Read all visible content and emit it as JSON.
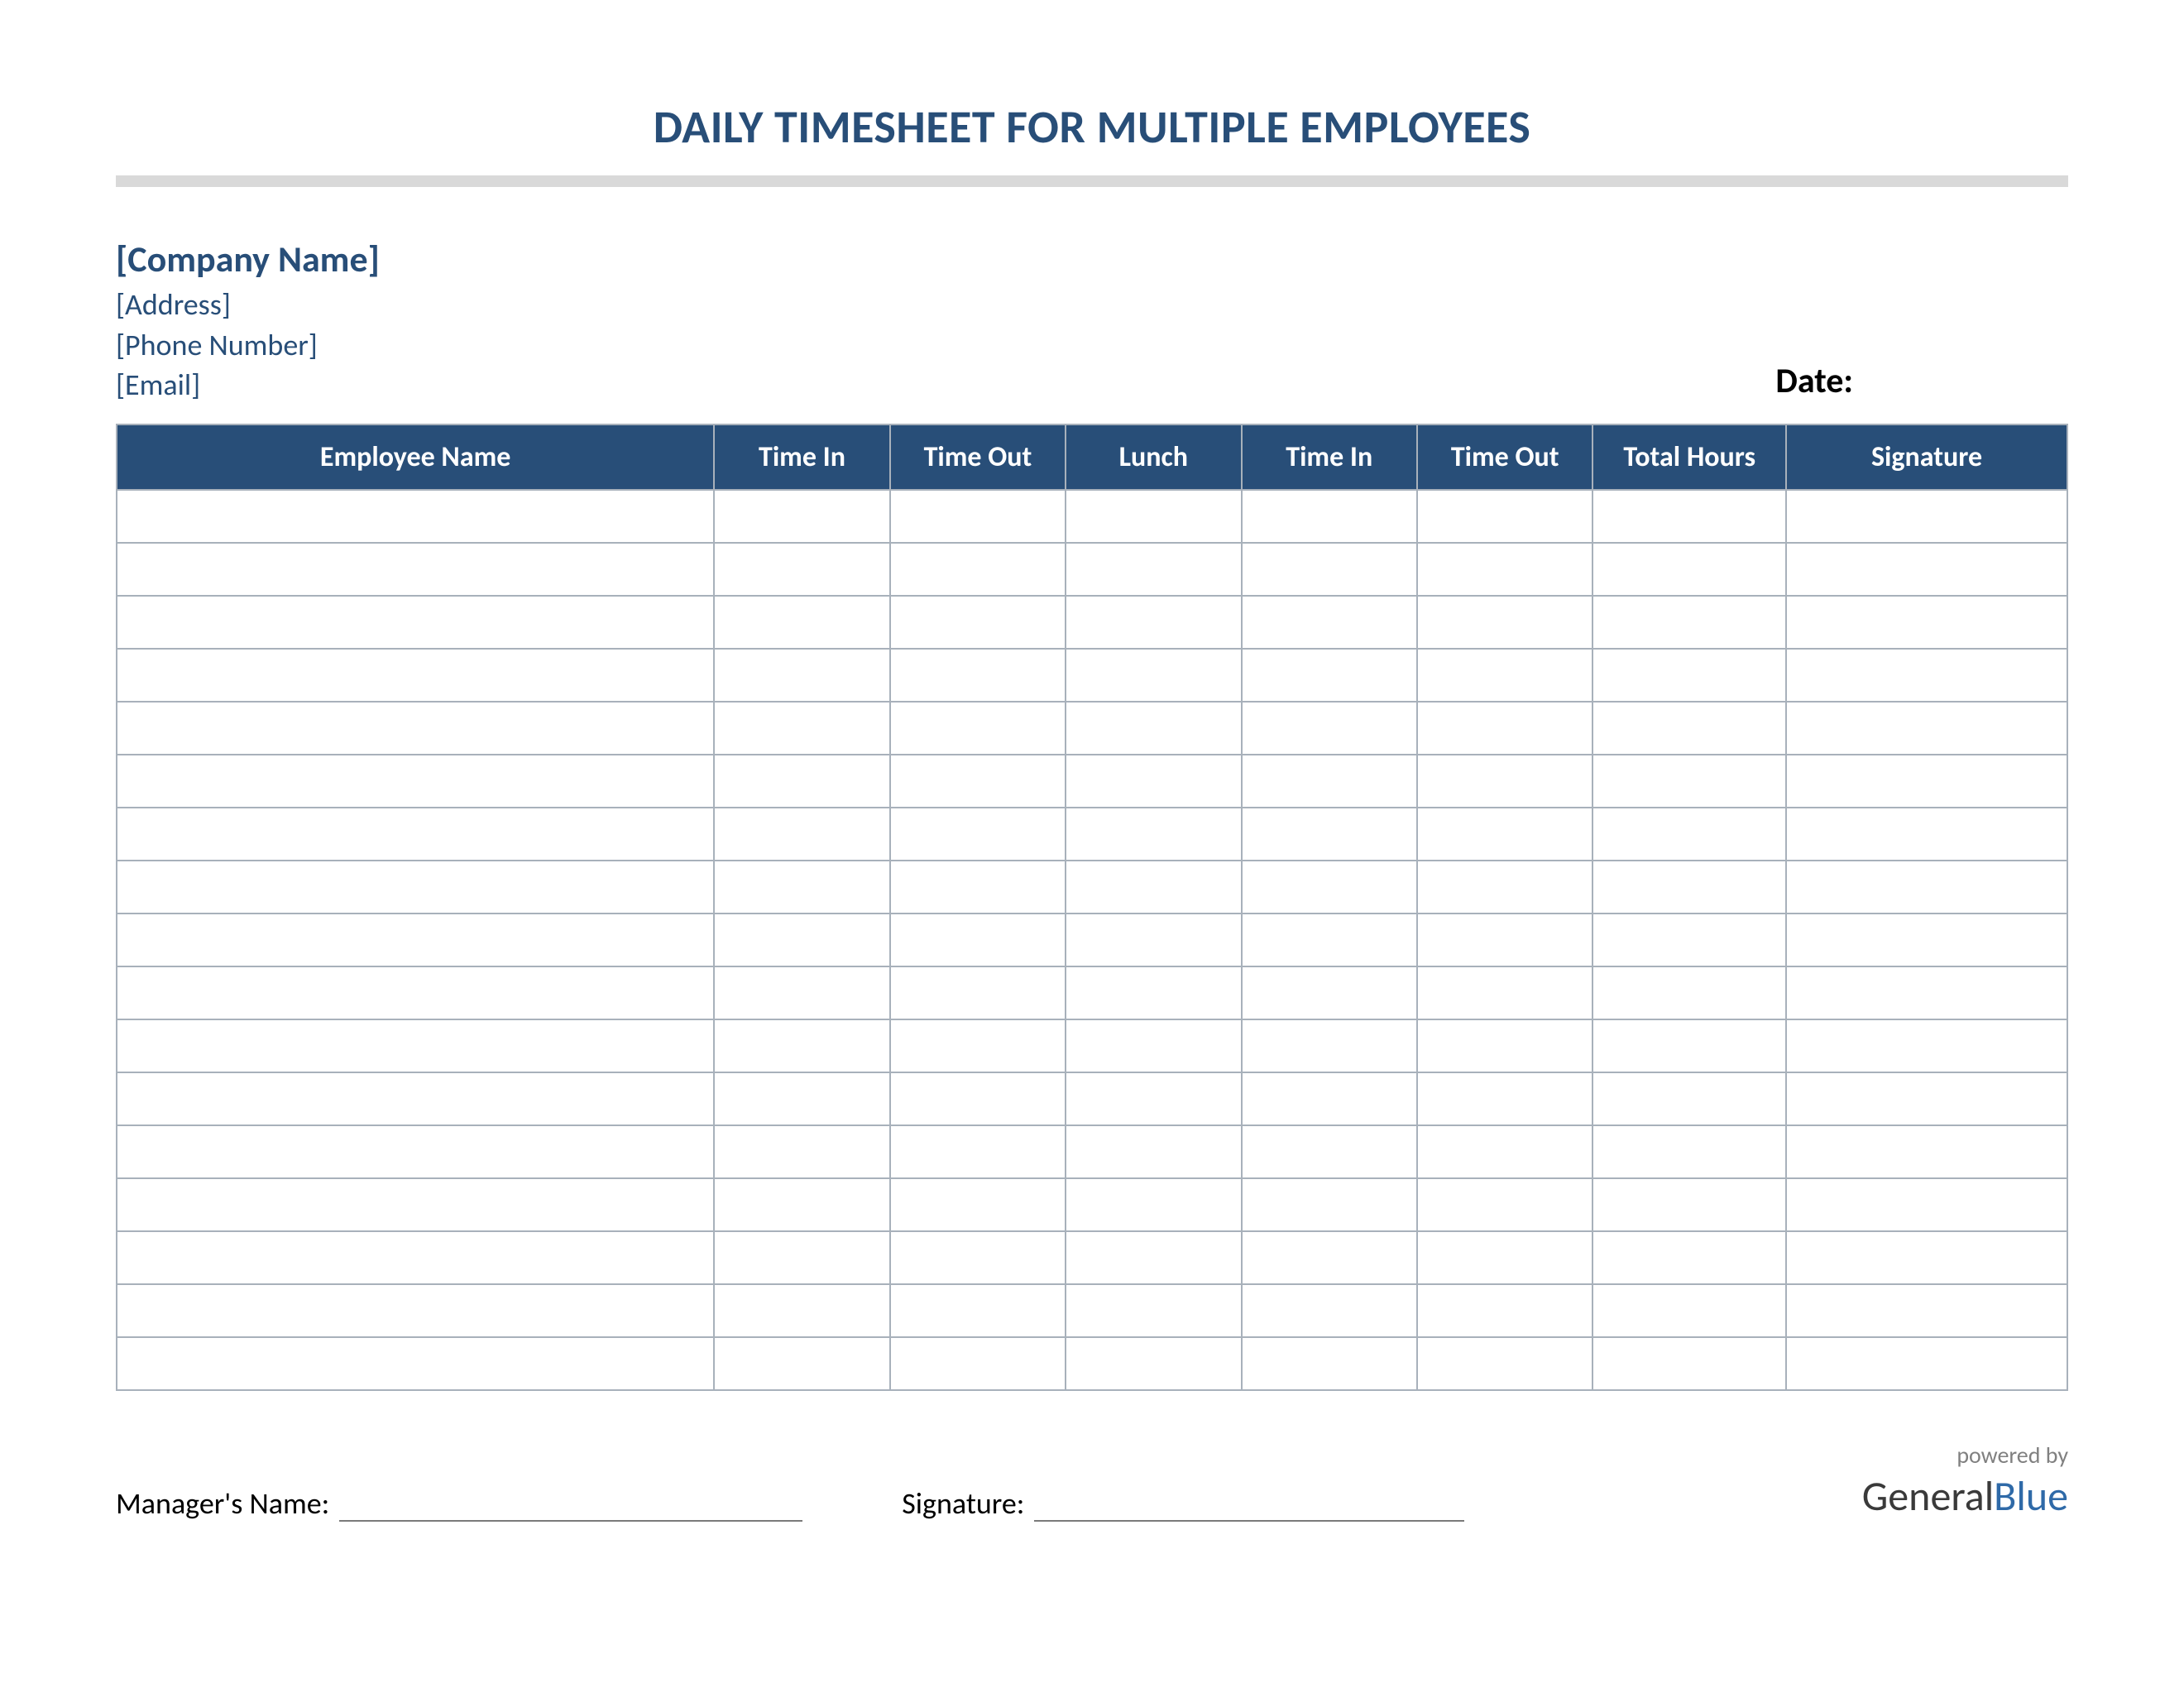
{
  "title": "DAILY TIMESHEET FOR MULTIPLE EMPLOYEES",
  "company": {
    "name": "[Company Name]",
    "address": "[Address]",
    "phone": "[Phone Number]",
    "email": "[Email]"
  },
  "date_label": "Date:",
  "table": {
    "headers": [
      "Employee Name",
      "Time In",
      "Time Out",
      "Lunch",
      "Time In",
      "Time Out",
      "Total Hours",
      "Signature"
    ],
    "row_count": 17
  },
  "footer": {
    "manager_label": "Manager's Name:",
    "signature_label": "Signature:"
  },
  "branding": {
    "powered_by": "powered by",
    "brand_part1": "General",
    "brand_part2": "Blue"
  },
  "colors": {
    "accent": "#284e78",
    "divider": "#d9d9d9",
    "border": "#a8b1bb"
  }
}
